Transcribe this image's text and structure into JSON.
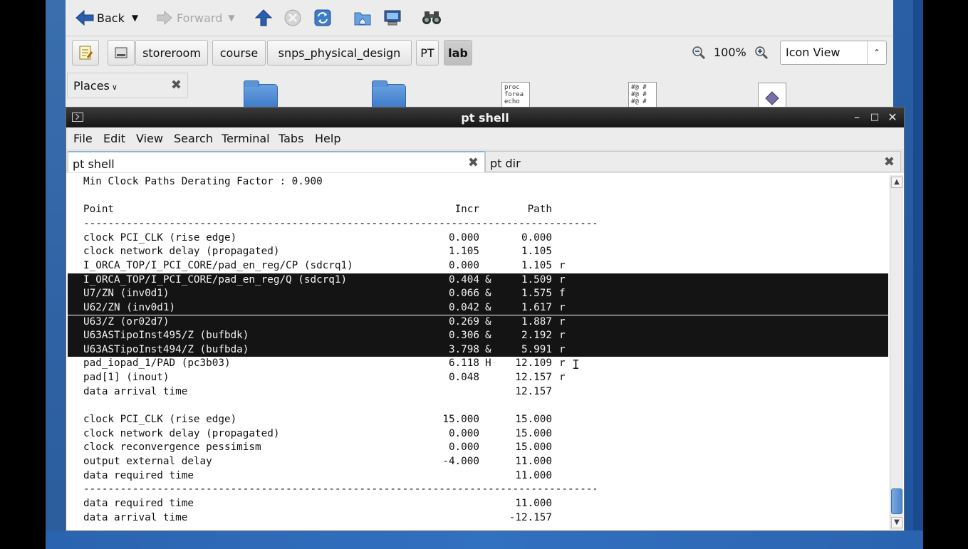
{
  "file_manager": {
    "toolbar": {
      "back_label": "Back",
      "forward_label": "Forward"
    },
    "path_buttons": [
      "storeroom",
      "course",
      "snps_physical_design",
      "PT",
      "lab"
    ],
    "active_path": "lab",
    "zoom": "100%",
    "view_mode": "Icon View",
    "places_label": "Places",
    "files": [
      {
        "type": "folder"
      },
      {
        "type": "folder"
      },
      {
        "type": "script",
        "preview": "proc\nforea\necho"
      },
      {
        "type": "script",
        "preview": "#@ #\n#@ #\n#@ #"
      },
      {
        "type": "other"
      }
    ]
  },
  "terminal": {
    "title": "pt shell",
    "menu": [
      "File",
      "Edit",
      "View",
      "Search",
      "Terminal",
      "Tabs",
      "Help"
    ],
    "tabs": [
      {
        "label": "pt shell",
        "active": true
      },
      {
        "label": "pt dir",
        "active": false
      }
    ],
    "lines": [
      {
        "point": "Min Clock Paths Derating Factor : 0.900",
        "incr": "",
        "flag": "",
        "path": "",
        "rf": "",
        "kind": "text"
      },
      {
        "point": "",
        "incr": "",
        "flag": "",
        "path": "",
        "rf": "",
        "kind": "blank"
      },
      {
        "point": "Point",
        "incr": "Incr",
        "flag": "",
        "path": "Path",
        "rf": "",
        "kind": "header"
      },
      {
        "point": "-------------------------------------------------------------------------------------------",
        "incr": "",
        "flag": "",
        "path": "",
        "rf": "",
        "kind": "dash"
      },
      {
        "point": "clock PCI_CLK (rise edge)",
        "incr": "0.000",
        "flag": "",
        "path": "0.000",
        "rf": "",
        "kind": "row"
      },
      {
        "point": "clock network delay (propagated)",
        "incr": "1.105",
        "flag": "",
        "path": "1.105",
        "rf": "",
        "kind": "row"
      },
      {
        "point": "I_ORCA_TOP/I_PCI_CORE/pad_en_reg/CP (sdcrq1)",
        "incr": "0.000",
        "flag": "",
        "path": "1.105",
        "rf": "r",
        "kind": "row"
      },
      {
        "point": "I_ORCA_TOP/I_PCI_CORE/pad_en_reg/Q (sdcrq1)",
        "incr": "0.404",
        "flag": "&",
        "path": "1.509",
        "rf": "r",
        "kind": "hl"
      },
      {
        "point": "U7/ZN (inv0d1)",
        "incr": "0.066",
        "flag": "&",
        "path": "1.575",
        "rf": "f",
        "kind": "hl"
      },
      {
        "point": "U62/ZN (inv0d1)",
        "incr": "0.042",
        "flag": "&",
        "path": "1.617",
        "rf": "r",
        "kind": "hl"
      },
      {
        "point": "U63/Z (or02d7)",
        "incr": "0.269",
        "flag": "&",
        "path": "1.887",
        "rf": "r",
        "kind": "hl"
      },
      {
        "point": "U63ASTipoInst495/Z (bufbdk)",
        "incr": "0.306",
        "flag": "&",
        "path": "2.192",
        "rf": "r",
        "kind": "hl"
      },
      {
        "point": "U63ASTipoInst494/Z (bufbda)",
        "incr": "3.798",
        "flag": "&",
        "path": "5.991",
        "rf": "r",
        "kind": "hl"
      },
      {
        "point": "pad_iopad_1/PAD (pc3b03)",
        "incr": "6.118",
        "flag": "H",
        "path": "12.109",
        "rf": "r",
        "kind": "row"
      },
      {
        "point": "pad[1] (inout)",
        "incr": "0.048",
        "flag": "",
        "path": "12.157",
        "rf": "r",
        "kind": "row"
      },
      {
        "point": "data arrival time",
        "incr": "",
        "flag": "",
        "path": "12.157",
        "rf": "",
        "kind": "row"
      },
      {
        "point": "",
        "incr": "",
        "flag": "",
        "path": "",
        "rf": "",
        "kind": "blank"
      },
      {
        "point": "clock PCI_CLK (rise edge)",
        "incr": "15.000",
        "flag": "",
        "path": "15.000",
        "rf": "",
        "kind": "row"
      },
      {
        "point": "clock network delay (propagated)",
        "incr": "0.000",
        "flag": "",
        "path": "15.000",
        "rf": "",
        "kind": "row"
      },
      {
        "point": "clock reconvergence pessimism",
        "incr": "0.000",
        "flag": "",
        "path": "15.000",
        "rf": "",
        "kind": "row"
      },
      {
        "point": "output external delay",
        "incr": "-4.000",
        "flag": "",
        "path": "11.000",
        "rf": "",
        "kind": "row"
      },
      {
        "point": "data required time",
        "incr": "",
        "flag": "",
        "path": "11.000",
        "rf": "",
        "kind": "row"
      },
      {
        "point": "-------------------------------------------------------------------------------------------",
        "incr": "",
        "flag": "",
        "path": "",
        "rf": "",
        "kind": "dash"
      },
      {
        "point": "data required time",
        "incr": "",
        "flag": "",
        "path": "11.000",
        "rf": "",
        "kind": "row"
      },
      {
        "point": "data arrival time",
        "incr": "",
        "flag": "",
        "path": "-12.157",
        "rf": "",
        "kind": "row"
      }
    ]
  }
}
